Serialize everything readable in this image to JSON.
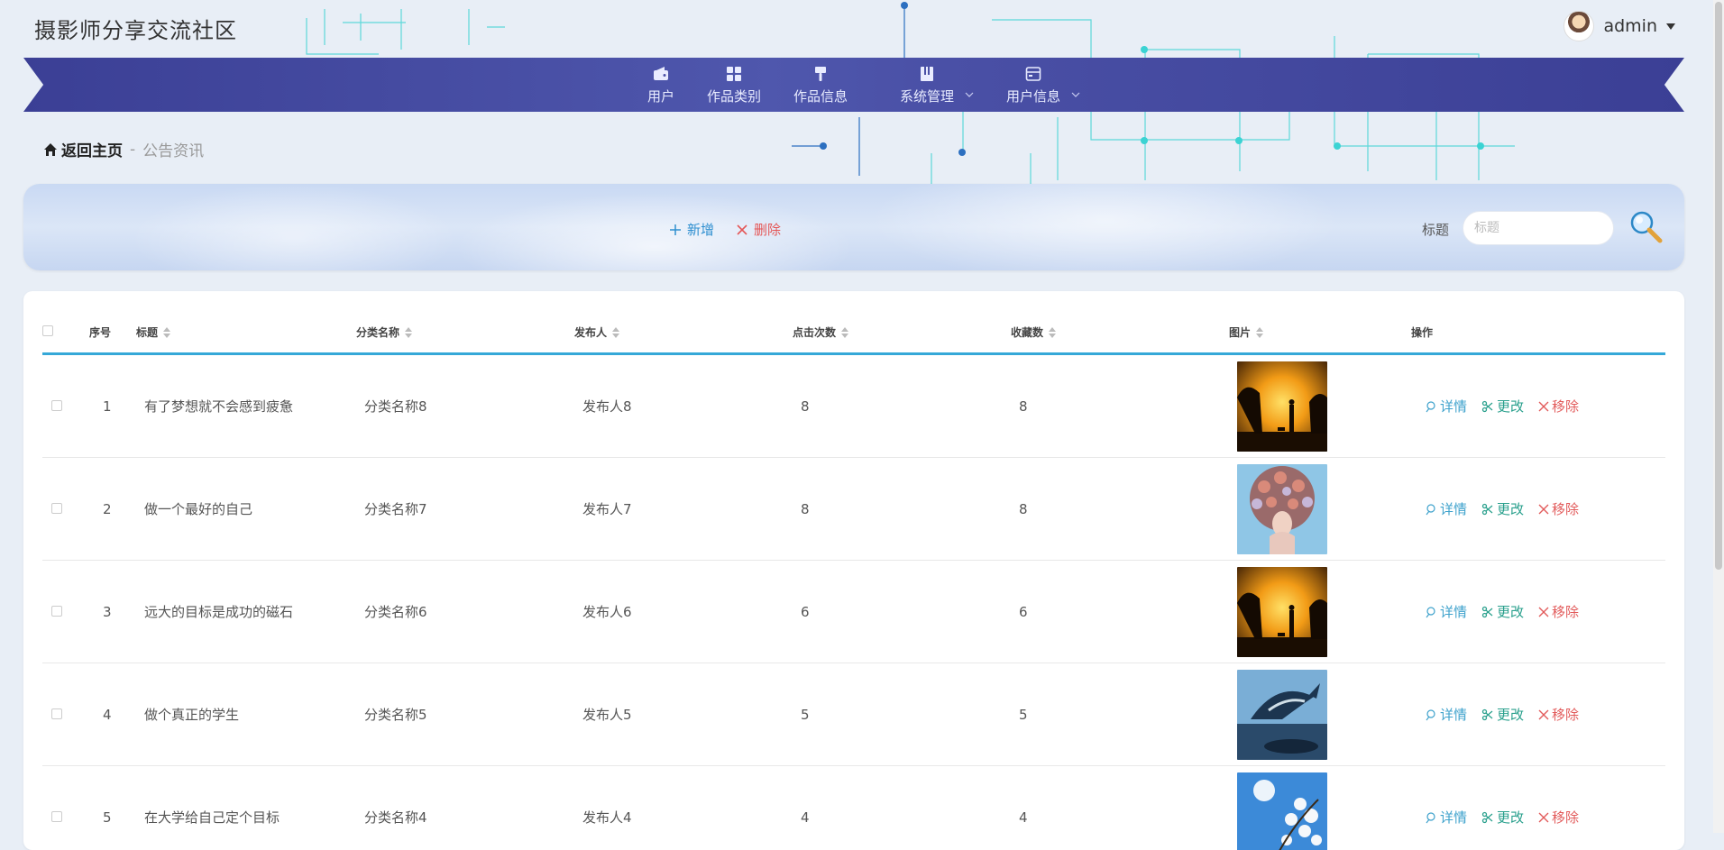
{
  "site_title": "摄影师分享交流社区",
  "user": {
    "name": "admin"
  },
  "nav": [
    {
      "label": "用户",
      "icon": "wallet-icon",
      "dropdown": false
    },
    {
      "label": "作品类别",
      "icon": "grid-icon",
      "dropdown": false
    },
    {
      "label": "作品信息",
      "icon": "brush-icon",
      "dropdown": false
    },
    {
      "label": "系统管理",
      "icon": "book-icon",
      "dropdown": true
    },
    {
      "label": "用户信息",
      "icon": "calendar-icon",
      "dropdown": true
    }
  ],
  "breadcrumb": {
    "home": "返回主页",
    "separator": "-",
    "current": "公告资讯"
  },
  "toolbar": {
    "add_label": "新增",
    "delete_label": "删除"
  },
  "search": {
    "label": "标题",
    "placeholder": "标题"
  },
  "table": {
    "headers": [
      "序号",
      "标题",
      "分类名称",
      "发布人",
      "点击次数",
      "收藏数",
      "图片",
      "操作"
    ],
    "sortable": [
      false,
      true,
      true,
      true,
      true,
      true,
      true,
      false
    ],
    "rows": [
      {
        "index": "1",
        "title": "有了梦想就不会感到疲惫",
        "category": "分类名称8",
        "publisher": "发布人8",
        "clicks": "8",
        "favorites": "8",
        "image": "sunset-silhouette"
      },
      {
        "index": "2",
        "title": "做一个最好的自己",
        "category": "分类名称7",
        "publisher": "发布人7",
        "clicks": "8",
        "favorites": "8",
        "image": "flower-hair-portrait"
      },
      {
        "index": "3",
        "title": "远大的目标是成功的磁石",
        "category": "分类名称6",
        "publisher": "发布人6",
        "clicks": "6",
        "favorites": "6",
        "image": "sunset-silhouette"
      },
      {
        "index": "4",
        "title": "做个真正的学生",
        "category": "分类名称5",
        "publisher": "发布人5",
        "clicks": "5",
        "favorites": "5",
        "image": "whale-sea"
      },
      {
        "index": "5",
        "title": "在大学给自己定个目标",
        "category": "分类名称4",
        "publisher": "发布人4",
        "clicks": "4",
        "favorites": "4",
        "image": "blossom-sky"
      }
    ],
    "row_actions": {
      "detail": "详情",
      "edit": "更改",
      "remove": "移除"
    }
  },
  "colors": {
    "nav": "#4a50a6",
    "accent": "#35a8d8",
    "detail": "#3ea2cc",
    "edit": "#2aa08d",
    "remove": "#e25b5b"
  }
}
